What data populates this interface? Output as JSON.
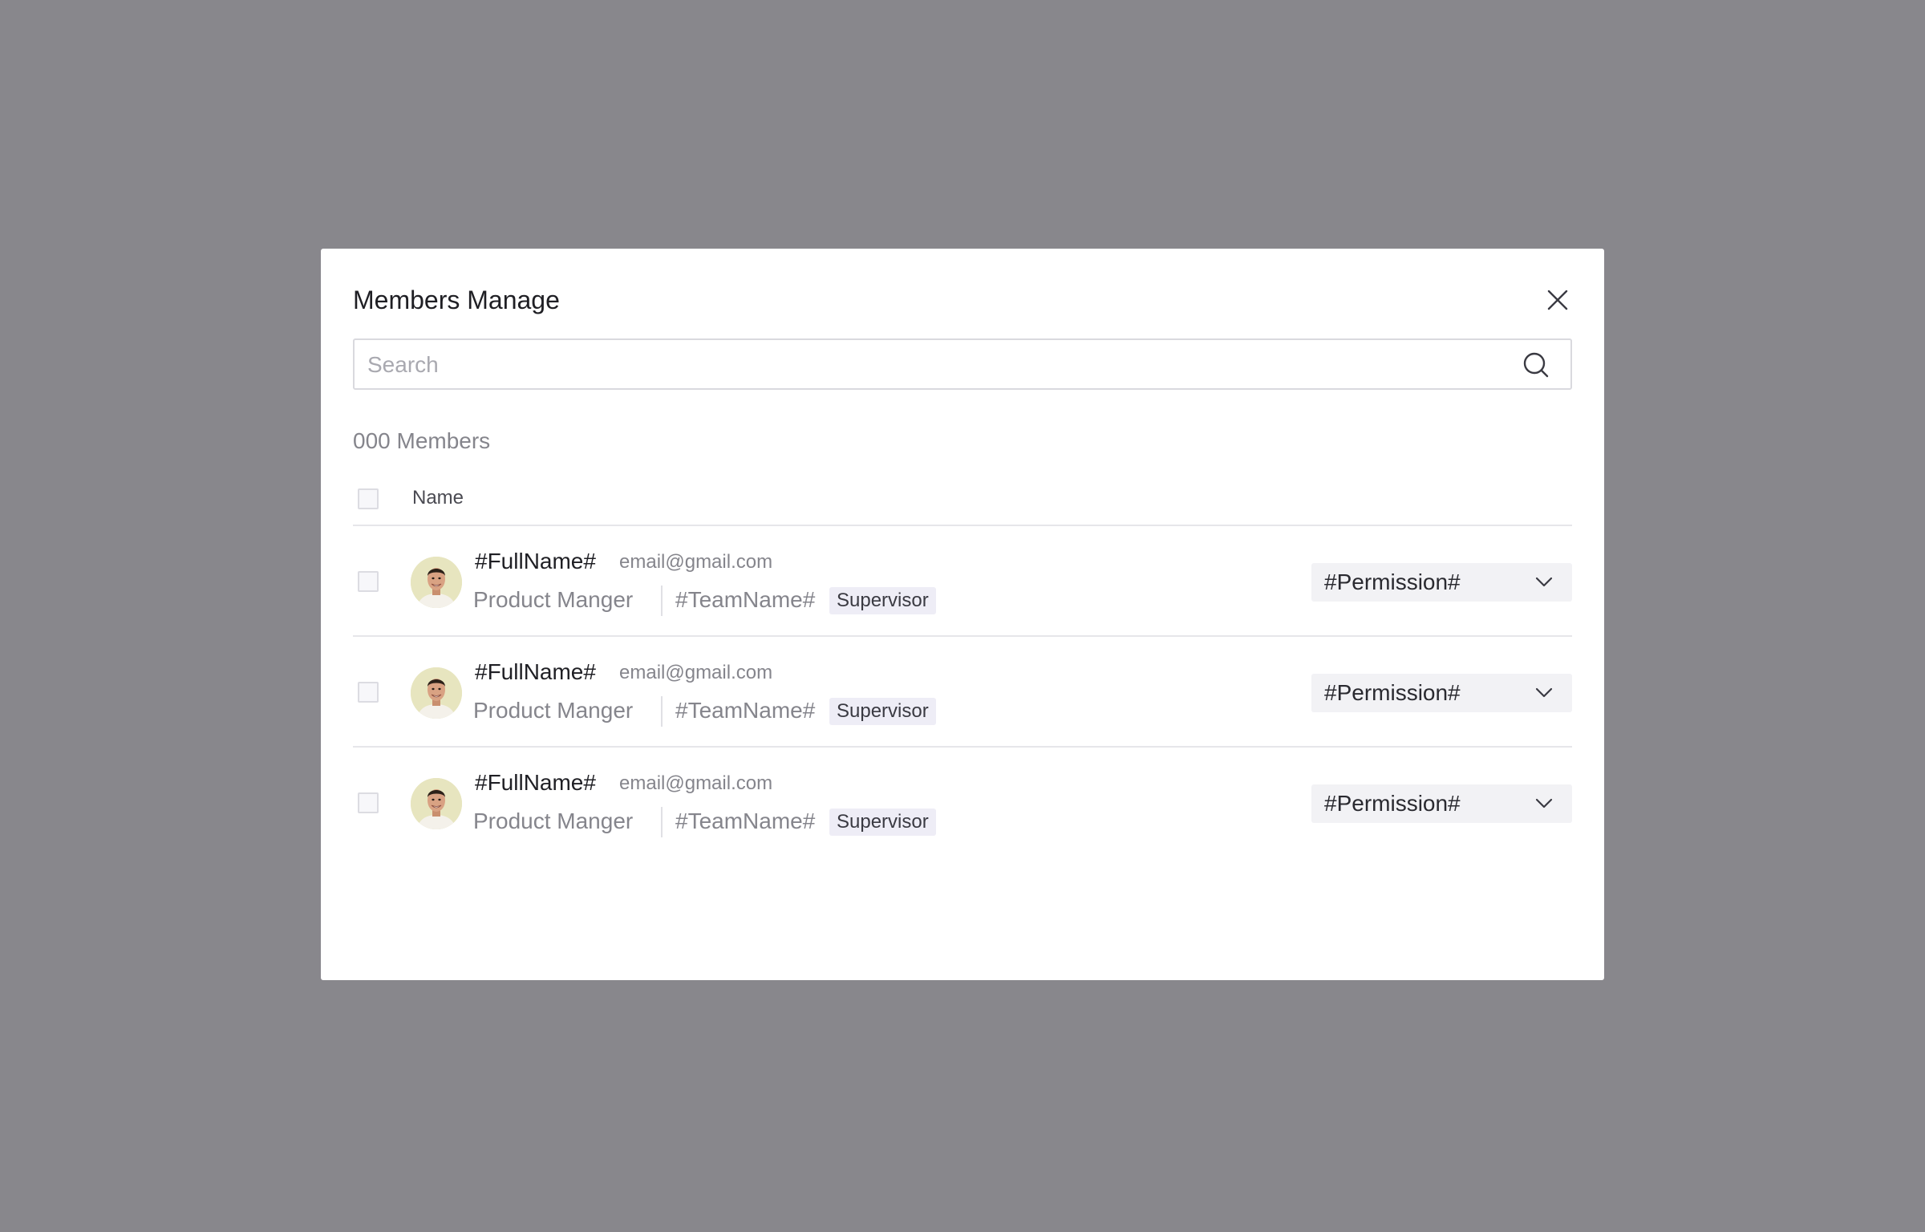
{
  "modal": {
    "title": "Members Manage",
    "close_icon": "close-icon"
  },
  "search": {
    "placeholder": "Search",
    "value": "",
    "icon": "search-icon"
  },
  "member_count": "000 Members",
  "table": {
    "header_name": "Name",
    "rows": [
      {
        "full_name": "#FullName#",
        "email": "email@gmail.com",
        "job_title": "Product Manger",
        "team_name": "#TeamName#",
        "role": "Supervisor",
        "permission": "#Permission#"
      },
      {
        "full_name": "#FullName#",
        "email": "email@gmail.com",
        "job_title": "Product Manger",
        "team_name": "#TeamName#",
        "role": "Supervisor",
        "permission": "#Permission#"
      },
      {
        "full_name": "#FullName#",
        "email": "email@gmail.com",
        "job_title": "Product Manger",
        "team_name": "#TeamName#",
        "role": "Supervisor",
        "permission": "#Permission#"
      }
    ]
  },
  "colors": {
    "overlay": "#88878c",
    "modal_bg": "#ffffff",
    "badge_bg": "#eeedf6",
    "select_bg": "#f2f2f5",
    "avatar_bg": "#e7e5bf"
  }
}
